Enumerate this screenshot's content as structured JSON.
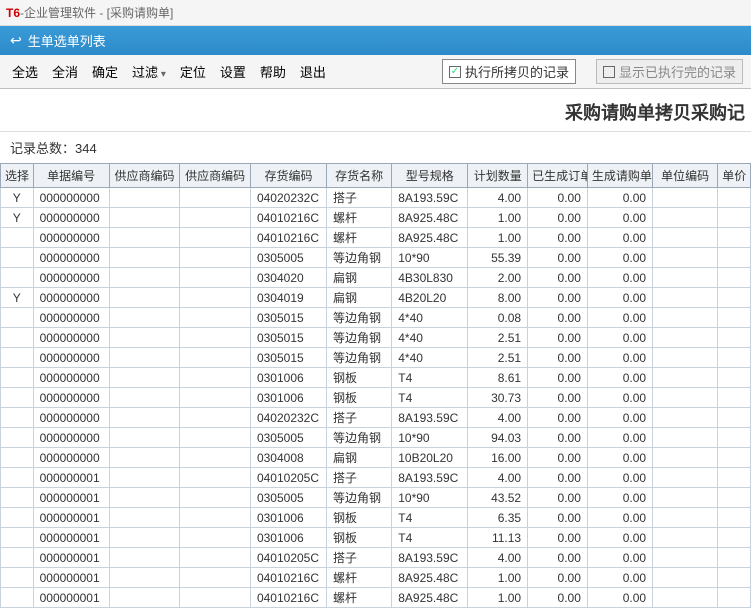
{
  "app": {
    "t6": "T6",
    "suffix": "-企业管理软件 - [采购请购单]"
  },
  "window": {
    "title": "生单选单列表"
  },
  "toolbar": {
    "select_all": "全选",
    "deselect_all": "全消",
    "confirm": "确定",
    "filter": "过滤",
    "locate": "定位",
    "settings": "设置",
    "help": "帮助",
    "exit": "退出",
    "chk_copy": "执行所拷贝的记录",
    "chk_done": "显示已执行完的记录"
  },
  "report": {
    "title": "采购请购单拷贝采购记"
  },
  "count": {
    "label": "记录总数：",
    "value": "344"
  },
  "columns": [
    "选择",
    "单据编号",
    "供应商编码",
    "供应商编码",
    "存货编码",
    "存货名称",
    "型号规格",
    "计划数量",
    "已生成订单数",
    "生成请购单",
    "单位编码",
    "单价"
  ],
  "rows": [
    {
      "sel": "Y",
      "dj": "000000000",
      "g1": "",
      "g2": "",
      "ch": "04020232C",
      "cm": "搭子",
      "xh": "8A193.59C",
      "jh": "4.00",
      "dd": "0.00",
      "qg": "0.00"
    },
    {
      "sel": "Y",
      "dj": "000000000",
      "g1": "",
      "g2": "",
      "ch": "04010216C",
      "cm": "螺杆",
      "xh": "8A925.48C",
      "jh": "1.00",
      "dd": "0.00",
      "qg": "0.00"
    },
    {
      "sel": "",
      "dj": "000000000",
      "g1": "",
      "g2": "",
      "ch": "04010216C",
      "cm": "螺杆",
      "xh": "8A925.48C",
      "jh": "1.00",
      "dd": "0.00",
      "qg": "0.00"
    },
    {
      "sel": "",
      "dj": "000000000",
      "g1": "",
      "g2": "",
      "ch": "0305005",
      "cm": "等边角钢",
      "xh": "10*90",
      "jh": "55.39",
      "dd": "0.00",
      "qg": "0.00"
    },
    {
      "sel": "",
      "dj": "000000000",
      "g1": "",
      "g2": "",
      "ch": "0304020",
      "cm": "扁钢",
      "xh": "4B30L830",
      "jh": "2.00",
      "dd": "0.00",
      "qg": "0.00"
    },
    {
      "sel": "Y",
      "dj": "000000000",
      "g1": "",
      "g2": "",
      "ch": "0304019",
      "cm": "扁钢",
      "xh": "4B20L20",
      "jh": "8.00",
      "dd": "0.00",
      "qg": "0.00"
    },
    {
      "sel": "",
      "dj": "000000000",
      "g1": "",
      "g2": "",
      "ch": "0305015",
      "cm": "等边角钢",
      "xh": "4*40",
      "jh": "0.08",
      "dd": "0.00",
      "qg": "0.00"
    },
    {
      "sel": "",
      "dj": "000000000",
      "g1": "",
      "g2": "",
      "ch": "0305015",
      "cm": "等边角钢",
      "xh": "4*40",
      "jh": "2.51",
      "dd": "0.00",
      "qg": "0.00"
    },
    {
      "sel": "",
      "dj": "000000000",
      "g1": "",
      "g2": "",
      "ch": "0305015",
      "cm": "等边角钢",
      "xh": "4*40",
      "jh": "2.51",
      "dd": "0.00",
      "qg": "0.00"
    },
    {
      "sel": "",
      "dj": "000000000",
      "g1": "",
      "g2": "",
      "ch": "0301006",
      "cm": "钢板",
      "xh": "T4",
      "jh": "8.61",
      "dd": "0.00",
      "qg": "0.00"
    },
    {
      "sel": "",
      "dj": "000000000",
      "g1": "",
      "g2": "",
      "ch": "0301006",
      "cm": "钢板",
      "xh": "T4",
      "jh": "30.73",
      "dd": "0.00",
      "qg": "0.00"
    },
    {
      "sel": "",
      "dj": "000000000",
      "g1": "",
      "g2": "",
      "ch": "04020232C",
      "cm": "搭子",
      "xh": "8A193.59C",
      "jh": "4.00",
      "dd": "0.00",
      "qg": "0.00"
    },
    {
      "sel": "",
      "dj": "000000000",
      "g1": "",
      "g2": "",
      "ch": "0305005",
      "cm": "等边角钢",
      "xh": "10*90",
      "jh": "94.03",
      "dd": "0.00",
      "qg": "0.00"
    },
    {
      "sel": "",
      "dj": "000000000",
      "g1": "",
      "g2": "",
      "ch": "0304008",
      "cm": "扁钢",
      "xh": "10B20L20",
      "jh": "16.00",
      "dd": "0.00",
      "qg": "0.00"
    },
    {
      "sel": "",
      "dj": "000000001",
      "g1": "",
      "g2": "",
      "ch": "04010205C",
      "cm": "搭子",
      "xh": "8A193.59C",
      "jh": "4.00",
      "dd": "0.00",
      "qg": "0.00"
    },
    {
      "sel": "",
      "dj": "000000001",
      "g1": "",
      "g2": "",
      "ch": "0305005",
      "cm": "等边角钢",
      "xh": "10*90",
      "jh": "43.52",
      "dd": "0.00",
      "qg": "0.00"
    },
    {
      "sel": "",
      "dj": "000000001",
      "g1": "",
      "g2": "",
      "ch": "0301006",
      "cm": "钢板",
      "xh": "T4",
      "jh": "6.35",
      "dd": "0.00",
      "qg": "0.00"
    },
    {
      "sel": "",
      "dj": "000000001",
      "g1": "",
      "g2": "",
      "ch": "0301006",
      "cm": "钢板",
      "xh": "T4",
      "jh": "11.13",
      "dd": "0.00",
      "qg": "0.00"
    },
    {
      "sel": "",
      "dj": "000000001",
      "g1": "",
      "g2": "",
      "ch": "04010205C",
      "cm": "搭子",
      "xh": "8A193.59C",
      "jh": "4.00",
      "dd": "0.00",
      "qg": "0.00"
    },
    {
      "sel": "",
      "dj": "000000001",
      "g1": "",
      "g2": "",
      "ch": "04010216C",
      "cm": "螺杆",
      "xh": "8A925.48C",
      "jh": "1.00",
      "dd": "0.00",
      "qg": "0.00"
    },
    {
      "sel": "",
      "dj": "000000001",
      "g1": "",
      "g2": "",
      "ch": "04010216C",
      "cm": "螺杆",
      "xh": "8A925.48C",
      "jh": "1.00",
      "dd": "0.00",
      "qg": "0.00"
    }
  ]
}
